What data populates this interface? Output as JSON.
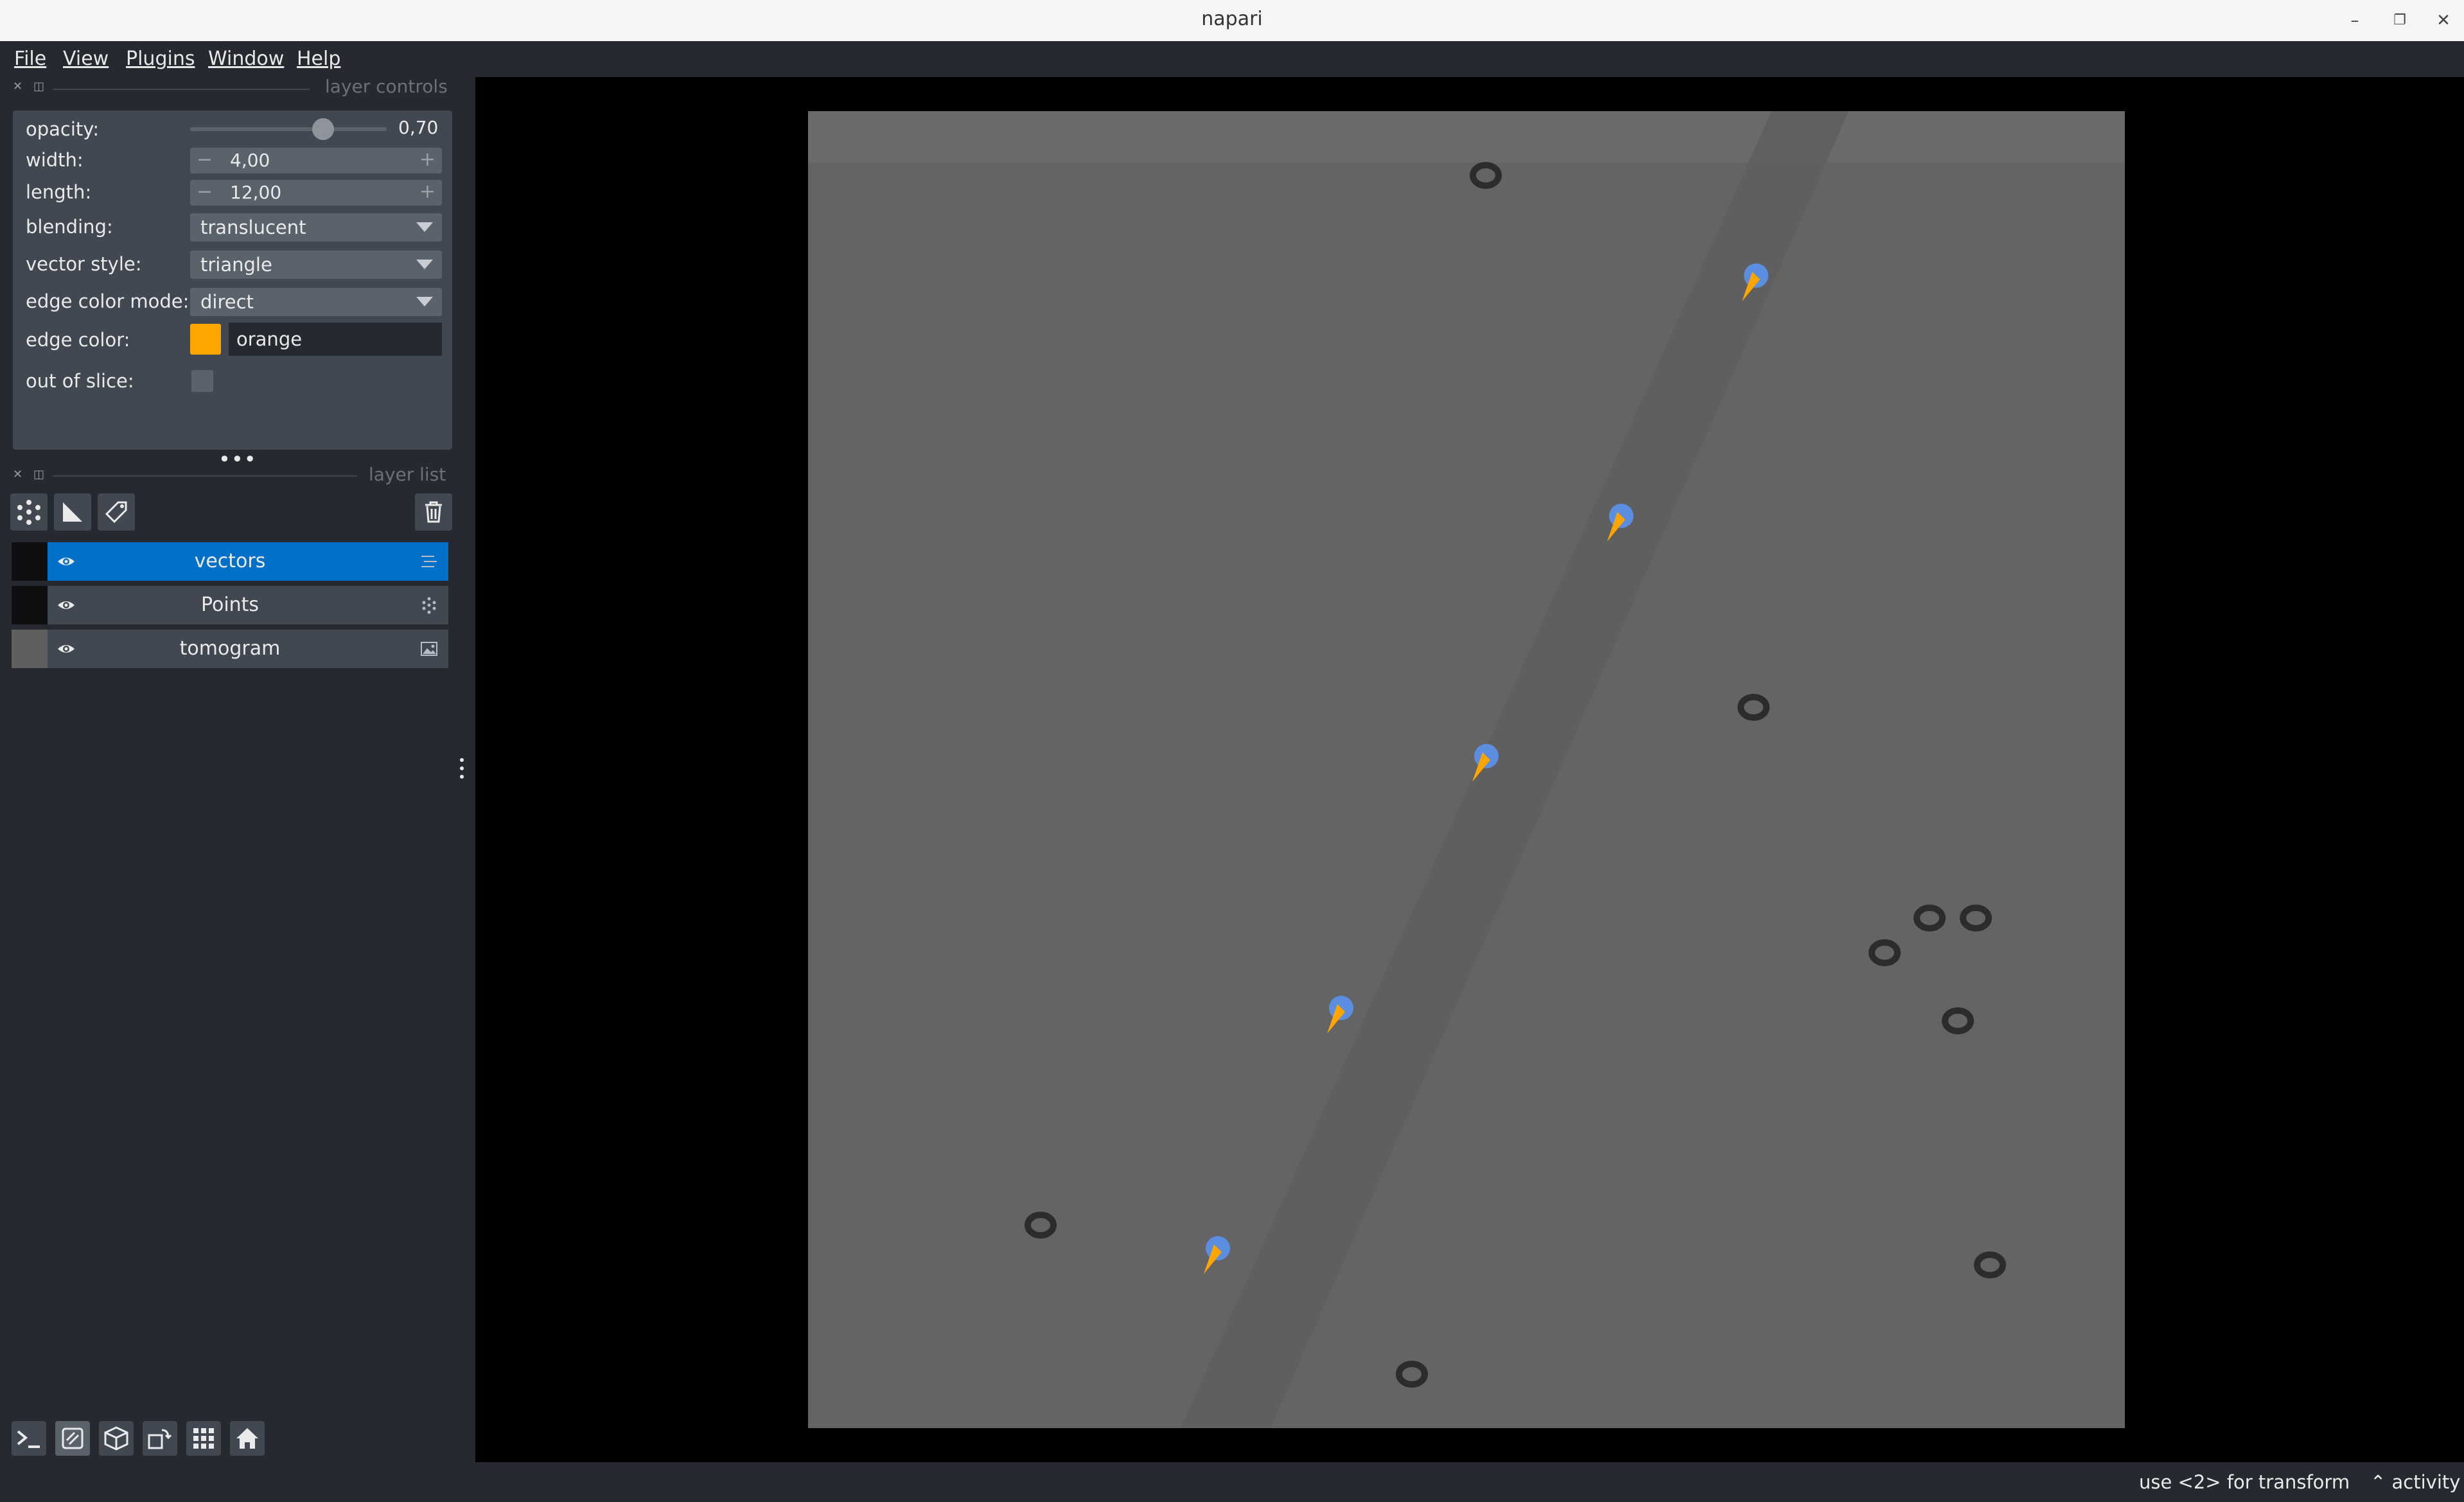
{
  "window": {
    "title": "napari",
    "minimize": "–",
    "restore": "❐",
    "close": "✕"
  },
  "menu": {
    "file": "File",
    "view": "View",
    "plugins": "Plugins",
    "window": "Window",
    "help": "Help"
  },
  "layer_controls": {
    "title": "layer controls",
    "opacity": {
      "label": "opacity:",
      "value": "0,70",
      "fraction": 0.7
    },
    "width": {
      "label": "width:",
      "value": "4,00"
    },
    "length": {
      "label": "length:",
      "value": "12,00"
    },
    "blending": {
      "label": "blending:",
      "value": "translucent"
    },
    "vector_style": {
      "label": "vector style:",
      "value": "triangle"
    },
    "edge_color_mode": {
      "label": "edge color mode:",
      "value": "direct"
    },
    "edge_color": {
      "label": "edge color:",
      "value": "orange",
      "swatch": "#ffa500"
    },
    "out_of_slice": {
      "label": "out of slice:",
      "checked": false
    }
  },
  "layer_list": {
    "title": "layer list",
    "layers": [
      {
        "name": "vectors",
        "selected": true,
        "visible": true,
        "type_icon": "vectors-icon"
      },
      {
        "name": "Points",
        "selected": false,
        "visible": true,
        "type_icon": "points-icon"
      },
      {
        "name": "tomogram",
        "selected": false,
        "visible": true,
        "type_icon": "image-icon"
      }
    ]
  },
  "status": {
    "hint": "use <2> for transform",
    "activity": "activity"
  },
  "colors": {
    "background": "#262930",
    "panel": "#414851",
    "selected": "#0070c9",
    "point": "#5b8de0",
    "vector": "#ffa500"
  }
}
